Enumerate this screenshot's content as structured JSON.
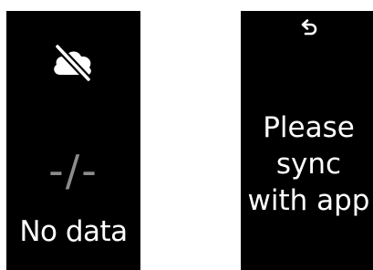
{
  "screens": [
    {
      "status_icon": "cloud-off-icon",
      "placeholder": "-/-",
      "label": "No data"
    },
    {
      "nav_icon": "back-arrow-icon",
      "message": "Please\nsync\nwith app"
    }
  ],
  "colors": {
    "screen_background": "#000000",
    "text": "#ffffff",
    "placeholder_text": "#8c8c8c"
  }
}
